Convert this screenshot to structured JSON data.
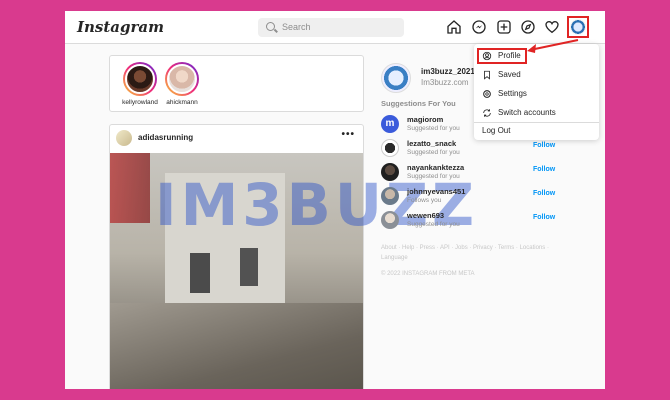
{
  "header": {
    "logo": "Instagram",
    "search_placeholder": "Search"
  },
  "stories": [
    {
      "name": "kellyrowland"
    },
    {
      "name": "ahickmann"
    }
  ],
  "post": {
    "username": "adidasrunning",
    "more": "•••"
  },
  "watermark": "IM3BUZZ",
  "sidebar": {
    "username": "im3buzz_2021",
    "fullname": "Im3buzz.com",
    "suggestions_title": "Suggestions For You",
    "suggestions": [
      {
        "name": "magiorom",
        "sub": "Suggested for you",
        "follow": "Follow"
      },
      {
        "name": "lezatto_snack",
        "sub": "Suggested for you",
        "follow": "Follow"
      },
      {
        "name": "nayankanktezza",
        "sub": "Suggested for you",
        "follow": "Follow"
      },
      {
        "name": "johnnyevans451",
        "sub": "Follows you",
        "follow": "Follow"
      },
      {
        "name": "wewen693",
        "sub": "Suggested for you",
        "follow": "Follow"
      }
    ],
    "footer_links": "About · Help · Press · API · Jobs · Privacy · Terms · Locations · Language",
    "copyright": "© 2022 INSTAGRAM FROM META"
  },
  "menu": {
    "items": [
      {
        "label": "Profile"
      },
      {
        "label": "Saved"
      },
      {
        "label": "Settings"
      },
      {
        "label": "Switch accounts"
      }
    ],
    "logout": "Log Out"
  },
  "colors": {
    "background": "#d93a8e",
    "highlight": "#e02424",
    "link": "#0095f6"
  }
}
